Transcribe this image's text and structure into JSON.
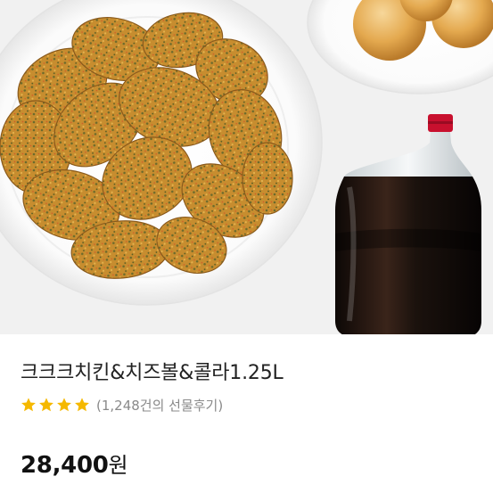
{
  "product": {
    "title": "크크크치킨&치즈볼&콜라1.25L",
    "rating": {
      "stars": 4,
      "max_stars": 4,
      "star_color": "#f5b800",
      "review_text": "(1,248건의 선물후기)"
    },
    "price": {
      "amount": "28,400",
      "unit": "원"
    }
  },
  "image": {
    "description_icon": "fried-chicken-cheeseball-cola-photo",
    "colors": {
      "background": "#f1f1f1",
      "plate": "#ffffff",
      "chicken": "#c98e2e",
      "cheese_ball": "#e9b464",
      "cola": "#1a1210",
      "cap": "#c8102e"
    }
  }
}
